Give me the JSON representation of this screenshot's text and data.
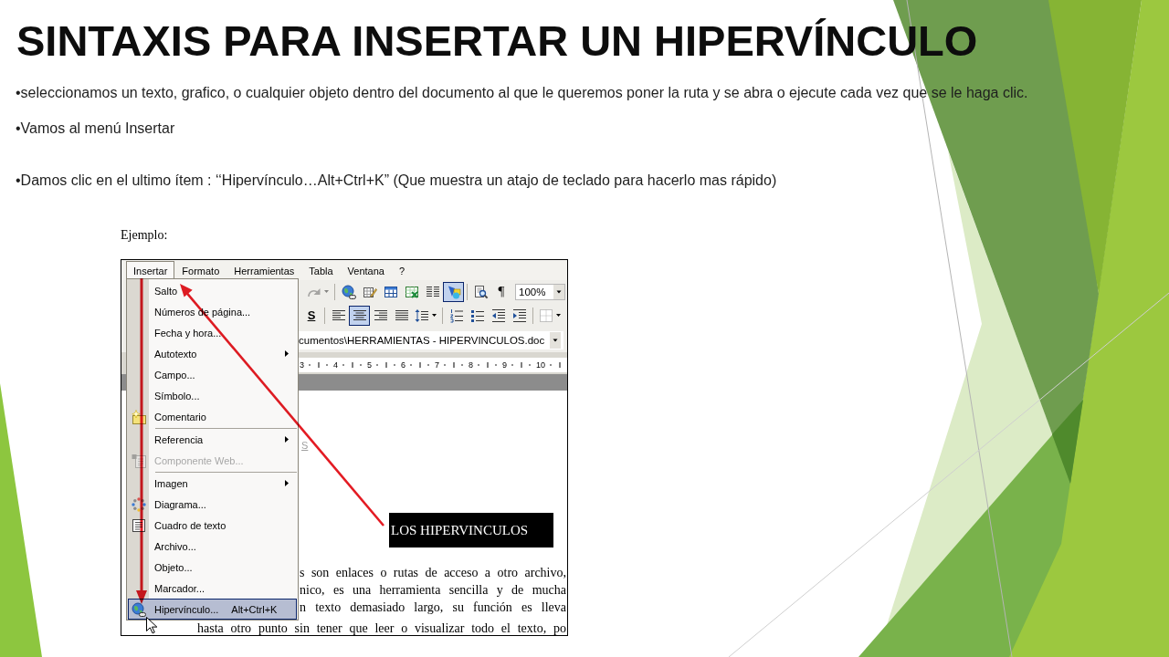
{
  "slide": {
    "title": "SINTAXIS PARA INSERTAR UN HIPERVÍNCULO",
    "bullets": [
      {
        "text": "•seleccionamos un texto, grafico, o cualquier objeto dentro del documento al que le queremos poner la ruta y se abra o ejecute cada vez que se le haga clic."
      },
      {
        "text": "•Vamos al menú Insertar"
      },
      {
        "text": "•Damos clic en el ultimo ítem : ‘‘Hipervínculo…Alt+Ctrl+K” (Que muestra un atajo de teclado para hacerlo mas rápido)"
      }
    ],
    "example_label": "Ejemplo:"
  },
  "word_window": {
    "menu_bar": [
      {
        "label": "Insertar",
        "selected": true
      },
      {
        "label": "Formato",
        "selected": false
      },
      {
        "label": "Herramientas",
        "selected": false
      },
      {
        "label": "Tabla",
        "selected": false
      },
      {
        "label": "Ventana",
        "selected": false
      },
      {
        "label": "?",
        "selected": false
      }
    ],
    "standard_toolbar": [
      {
        "kind": "button",
        "pressed": false,
        "disabled": true,
        "dropdown": true
      },
      {
        "kind": "separator"
      },
      {
        "kind": "button",
        "pressed": false,
        "disabled": false,
        "dropdown": false
      },
      {
        "kind": "button",
        "pressed": false,
        "disabled": false,
        "dropdown": false
      },
      {
        "kind": "button",
        "pressed": false,
        "disabled": false,
        "dropdown": false
      },
      {
        "kind": "button",
        "pressed": false,
        "disabled": false,
        "dropdown": false
      },
      {
        "kind": "button",
        "pressed": false,
        "disabled": false,
        "dropdown": false
      },
      {
        "kind": "button",
        "pressed": true,
        "disabled": false,
        "dropdown": false
      },
      {
        "kind": "separator"
      },
      {
        "kind": "button",
        "pressed": false,
        "disabled": false,
        "dropdown": false
      },
      {
        "kind": "text",
        "text": "¶",
        "pressed": false
      },
      {
        "kind": "combo",
        "value": "100%"
      }
    ],
    "formatting_toolbar": [
      {
        "kind": "text",
        "text": "S",
        "pressed": false
      },
      {
        "kind": "separator"
      },
      {
        "kind": "button",
        "pressed": false,
        "disabled": false,
        "dropdown": false
      },
      {
        "kind": "button",
        "pressed": true,
        "disabled": false,
        "dropdown": false
      },
      {
        "kind": "button",
        "pressed": false,
        "disabled": false,
        "dropdown": false
      },
      {
        "kind": "button",
        "pressed": false,
        "disabled": false,
        "dropdown": false
      },
      {
        "kind": "button",
        "pressed": false,
        "disabled": false,
        "dropdown": true
      },
      {
        "kind": "separator"
      },
      {
        "kind": "button",
        "pressed": false,
        "disabled": false,
        "dropdown": false
      },
      {
        "kind": "button",
        "pressed": false,
        "disabled": false,
        "dropdown": false
      },
      {
        "kind": "button",
        "pressed": false,
        "disabled": false,
        "dropdown": false
      },
      {
        "kind": "button",
        "pressed": false,
        "disabled": false,
        "dropdown": false
      },
      {
        "kind": "separator"
      },
      {
        "kind": "button",
        "pressed": false,
        "disabled": false,
        "dropdown": true
      }
    ],
    "address": "cumentos\\HERRAMIENTAS - HIPERVINCULOS.doc",
    "ruler": [
      "3",
      "4",
      "5",
      "6",
      "7",
      "8",
      "9",
      "10"
    ],
    "menu": [
      {
        "kind": "item",
        "label": "Salto",
        "selected": false,
        "disabled": false
      },
      {
        "kind": "item",
        "label": "Números de página...",
        "selected": false,
        "disabled": false
      },
      {
        "kind": "item",
        "label": "Fecha y hora...",
        "selected": false,
        "disabled": false
      },
      {
        "kind": "submenu",
        "label": "Autotexto",
        "selected": false,
        "disabled": false
      },
      {
        "kind": "item",
        "label": "Campo...",
        "selected": false,
        "disabled": false
      },
      {
        "kind": "item",
        "label": "Símbolo...",
        "selected": false,
        "disabled": false
      },
      {
        "kind": "item",
        "label": "Comentario",
        "selected": false,
        "disabled": false
      },
      {
        "kind": "separator"
      },
      {
        "kind": "submenu",
        "label": "Referencia",
        "selected": false,
        "disabled": false
      },
      {
        "kind": "item",
        "label": "Componente Web...",
        "selected": false,
        "disabled": true
      },
      {
        "kind": "separator"
      },
      {
        "kind": "submenu",
        "label": "Imagen",
        "selected": false,
        "disabled": false
      },
      {
        "kind": "item",
        "label": "Diagrama...",
        "selected": false,
        "disabled": false
      },
      {
        "kind": "item",
        "label": "Cuadro de texto",
        "selected": false,
        "disabled": false
      },
      {
        "kind": "item",
        "label": "Archivo...",
        "selected": false,
        "disabled": false
      },
      {
        "kind": "item",
        "label": "Objeto...",
        "selected": false,
        "disabled": false
      },
      {
        "kind": "item",
        "label": "Marcador...",
        "selected": false,
        "disabled": false
      },
      {
        "kind": "item",
        "label": "Hipervínculo...",
        "shortcut": "Alt+Ctrl+K",
        "selected": true,
        "disabled": false
      }
    ],
    "document": {
      "fragment": "S",
      "heading": "LOS HIPERVINCULOS",
      "lines": [
        "s son enlaces o rutas de acceso a otro archivo,",
        "nico, es una herramienta sencilla y de mucha",
        "n texto demasiado largo, su función es lleva",
        "hasta otro punto sin tener que leer o visualizar todo el texto, po"
      ]
    }
  }
}
